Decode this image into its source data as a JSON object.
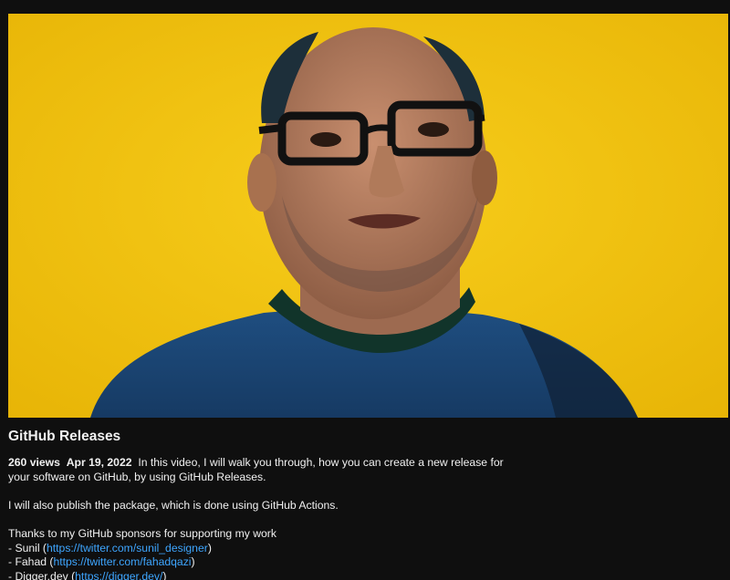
{
  "video": {
    "title": "GitHub Releases",
    "views": "260 views",
    "date": "Apr 19, 2022",
    "thumbnail_background": "#f2c20e"
  },
  "description": {
    "line1": "In this video, I will walk you through, how you can create a new release for",
    "line2": "your software on GitHub, by using GitHub Releases.",
    "line3": "I will also publish the package, which is done using GitHub Actions.",
    "line4": "Thanks to my GitHub sponsors for supporting my work",
    "sponsors": [
      {
        "prefix": "- Sunil (",
        "link": "https://twitter.com/sunil_designer",
        "suffix": ")"
      },
      {
        "prefix": "- Fahad (",
        "link": "https://twitter.com/fahadqazi",
        "suffix": ")"
      },
      {
        "prefix": "- Digger.dev (",
        "link": "https://digger.dev/",
        "suffix": ")"
      }
    ]
  },
  "colors": {
    "background": "#0f0f0f",
    "text": "#f1f1f1",
    "link": "#3ea6ff"
  }
}
